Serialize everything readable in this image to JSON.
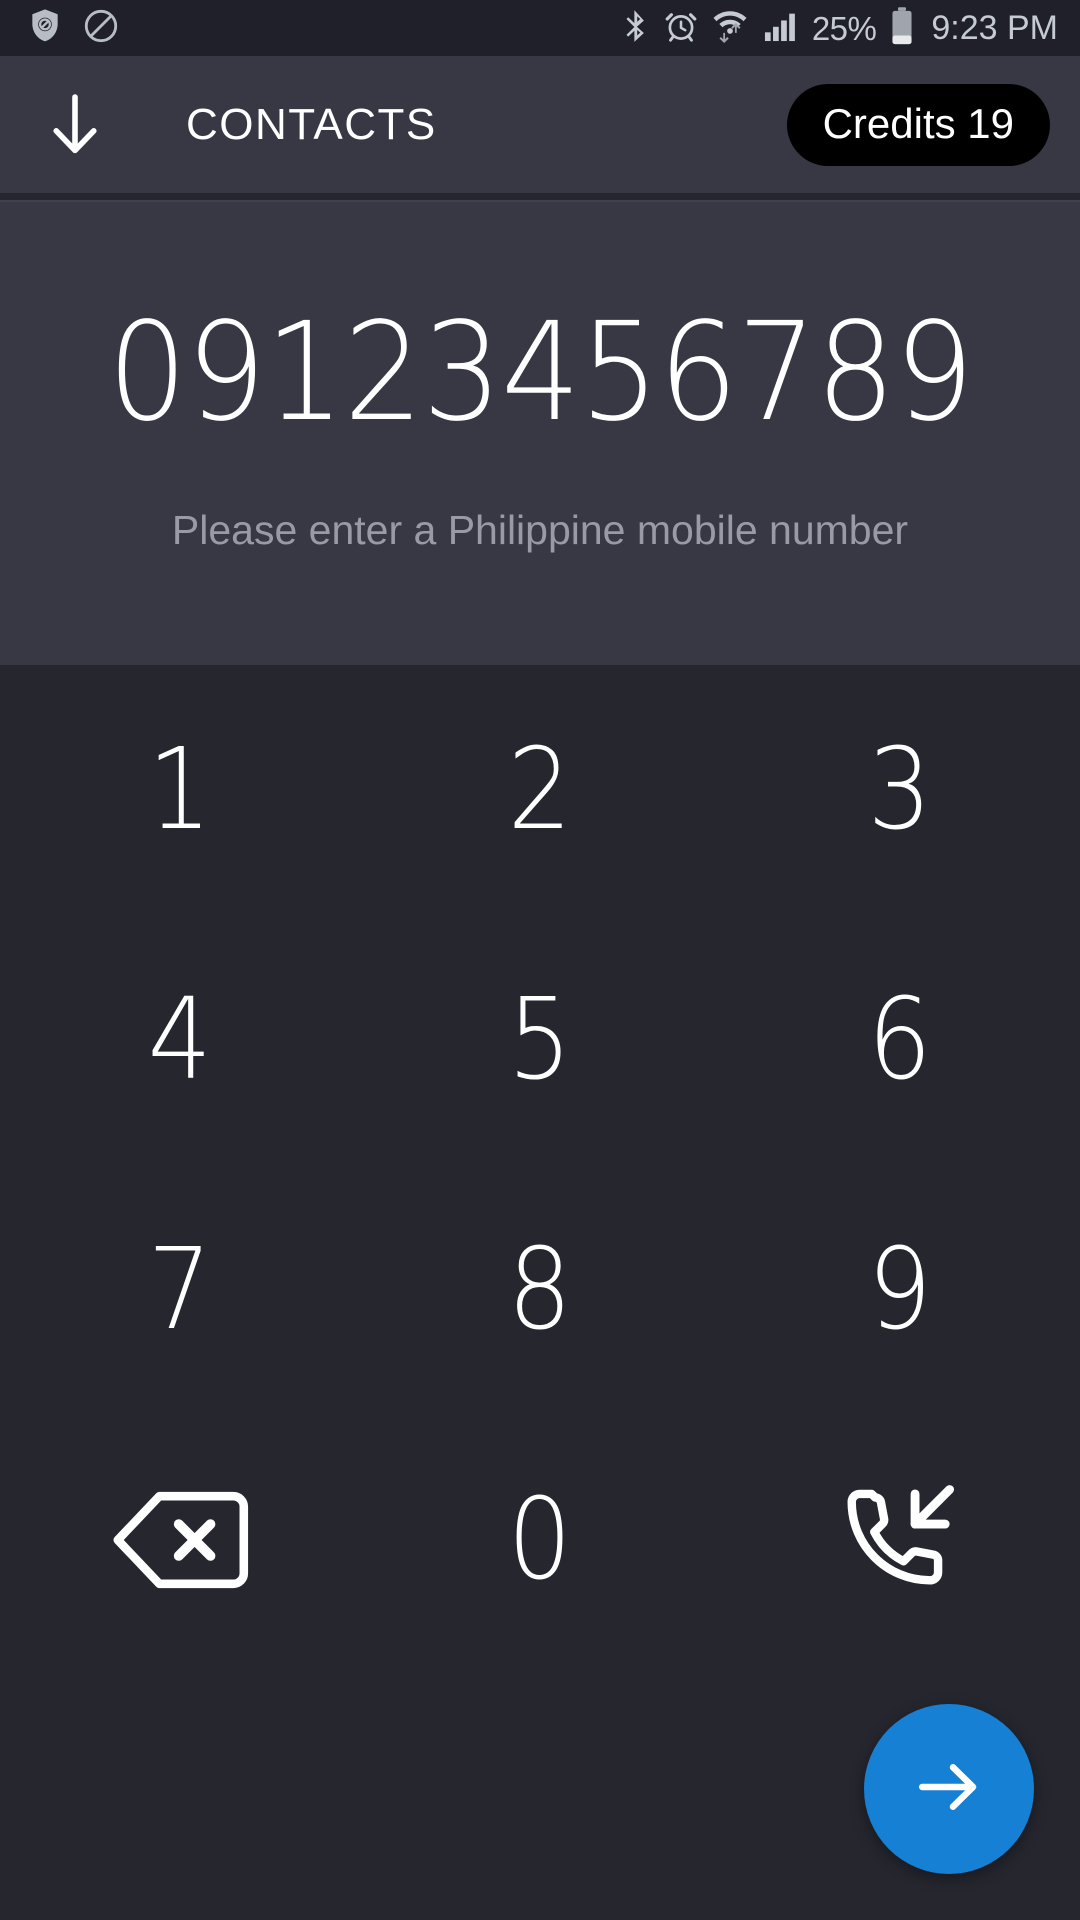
{
  "status_bar": {
    "icons_left": [
      "shield-block-icon",
      "do-not-disturb-icon"
    ],
    "icons_right": [
      "bluetooth-icon",
      "alarm-icon",
      "wifi-data-icon",
      "signal-icon",
      "battery-icon"
    ],
    "battery_percent": "25%",
    "clock": "9:23 PM",
    "background_color": "#1F2029",
    "icon_color": "#C6CAD2"
  },
  "header": {
    "back_icon": "arrow-down-icon",
    "title": "CONTACTS",
    "credits_label": "Credits 19",
    "background_color": "#383845",
    "pill_color": "#000000"
  },
  "display": {
    "number": "09123456789",
    "hint": "Please enter a Philippine mobile number",
    "background_color": "#383845",
    "hint_color": "#9A9AA6"
  },
  "keypad": {
    "background_color": "#25262E",
    "keys": [
      {
        "label": "1",
        "name": "key-1",
        "type": "digit"
      },
      {
        "label": "2",
        "name": "key-2",
        "type": "digit"
      },
      {
        "label": "3",
        "name": "key-3",
        "type": "digit"
      },
      {
        "label": "4",
        "name": "key-4",
        "type": "digit"
      },
      {
        "label": "5",
        "name": "key-5",
        "type": "digit"
      },
      {
        "label": "6",
        "name": "key-6",
        "type": "digit"
      },
      {
        "label": "7",
        "name": "key-7",
        "type": "digit"
      },
      {
        "label": "8",
        "name": "key-8",
        "type": "digit"
      },
      {
        "label": "9",
        "name": "key-9",
        "type": "digit"
      },
      {
        "label": "",
        "name": "backspace-icon",
        "type": "icon"
      },
      {
        "label": "0",
        "name": "key-0",
        "type": "digit"
      },
      {
        "label": "",
        "name": "incoming-call-icon",
        "type": "icon"
      }
    ]
  },
  "fab": {
    "icon": "arrow-right-icon",
    "color": "#1580D4"
  }
}
